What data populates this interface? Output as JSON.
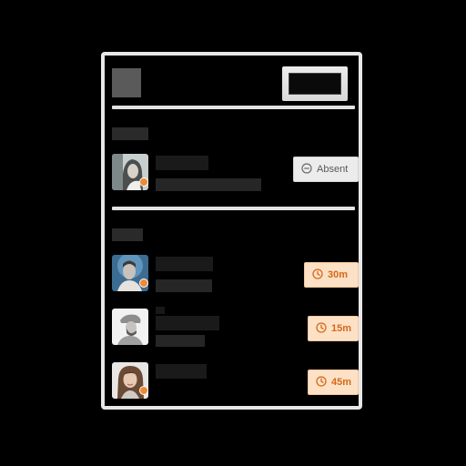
{
  "header": {
    "title": "",
    "button_label": ""
  },
  "sections": {
    "top_label": "",
    "bottom_label": ""
  },
  "absent_row": {
    "name": "",
    "subtitle": "",
    "status": "Absent"
  },
  "queue": [
    {
      "name": "",
      "subtitle": "",
      "wait": "30m"
    },
    {
      "pre_name": "",
      "name": "",
      "subtitle": "",
      "wait": "15m"
    },
    {
      "name": "",
      "subtitle": "",
      "wait": "45m"
    }
  ],
  "colors": {
    "accent_orange": "#ee8a35",
    "wait_badge_bg": "#fde1c6",
    "wait_badge_text": "#d4691a",
    "absent_badge_bg": "#ececec",
    "card_border": "#e7e7e7"
  },
  "icons": {
    "absent": "minus-circle-icon",
    "wait": "clock-icon",
    "status": "status-dot"
  }
}
